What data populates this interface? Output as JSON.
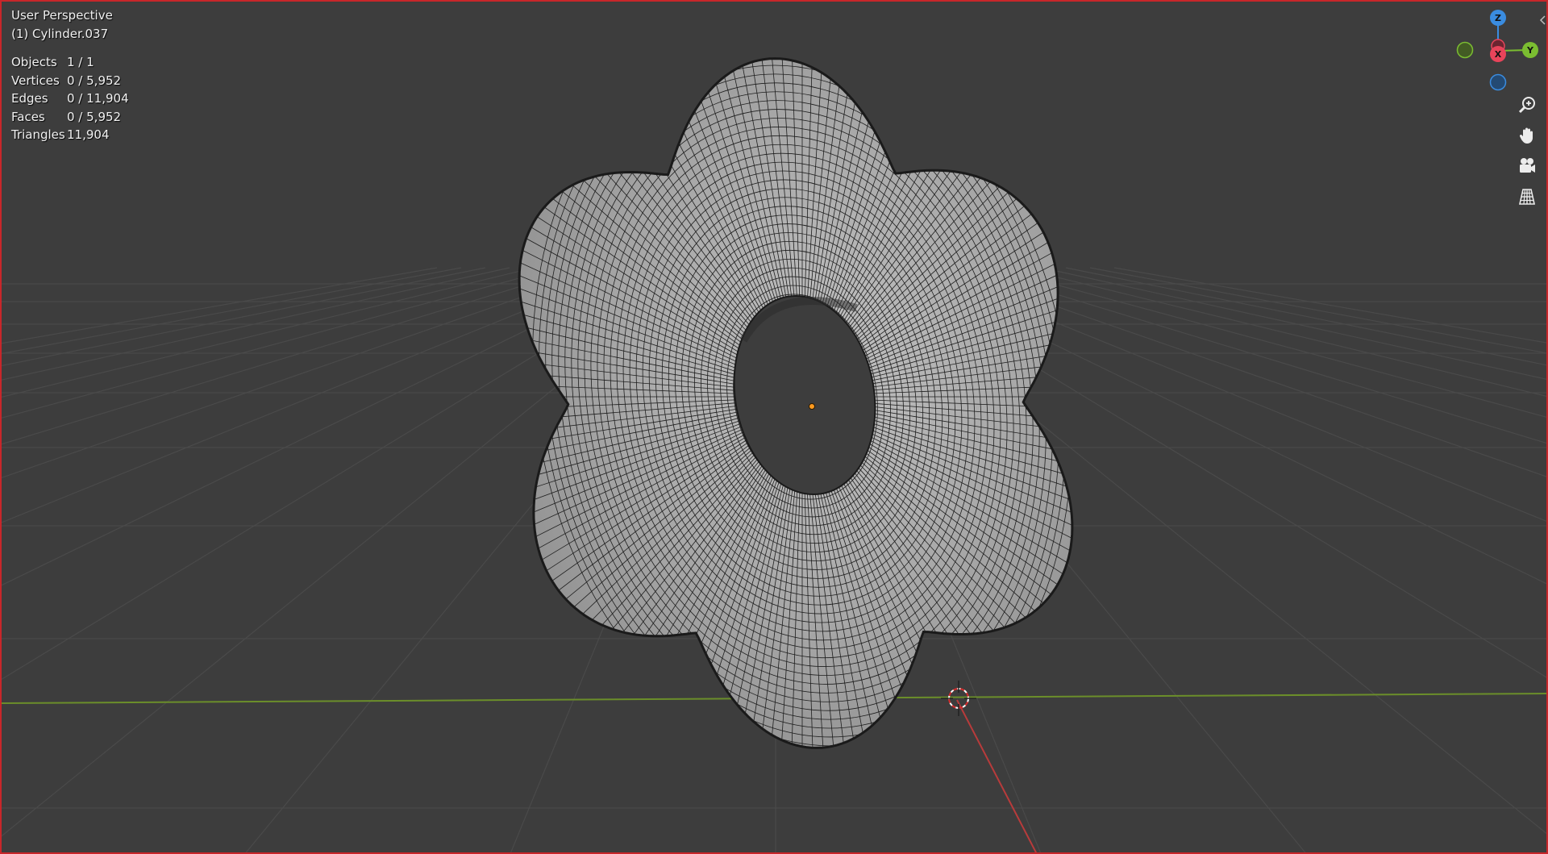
{
  "viewport": {
    "view_name": "User Perspective",
    "object_name": "(1) Cylinder.037"
  },
  "stats": [
    {
      "label": "Objects",
      "value": "1 / 1"
    },
    {
      "label": "Vertices",
      "value": "0 / 5,952"
    },
    {
      "label": "Edges",
      "value": "0 / 11,904"
    },
    {
      "label": "Faces",
      "value": "0 / 5,952"
    },
    {
      "label": "Triangles",
      "value": "11,904"
    }
  ],
  "gizmo": {
    "z_label": "Z",
    "y_label": "Y",
    "x_label": "X",
    "colors": {
      "x": "#e8445a",
      "y": "#7bbd31",
      "z": "#3a8ce0"
    }
  },
  "nav_tools": [
    {
      "name": "zoom-icon"
    },
    {
      "name": "pan-hand-icon"
    },
    {
      "name": "camera-icon"
    },
    {
      "name": "orthographic-grid-icon"
    }
  ],
  "colors": {
    "background": "#3d3d3d",
    "viewport_border": "#c8262a",
    "mesh": "#a9a9a9",
    "wire": "#1b1b1b",
    "x_axis": "#b83b3b",
    "y_axis": "#6b8e2a"
  }
}
